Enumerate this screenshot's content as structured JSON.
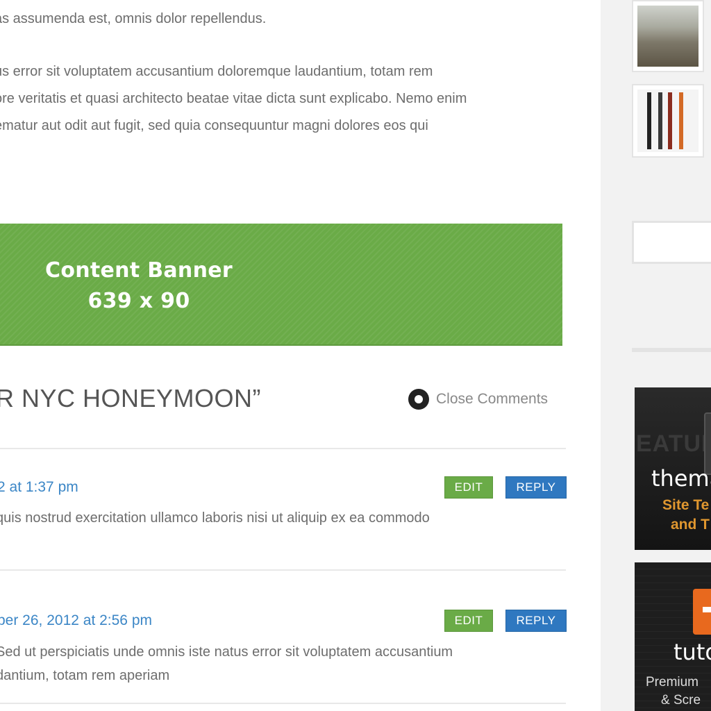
{
  "post": {
    "paragraph1": "as assumenda est, omnis dolor repellendus.",
    "paragraph2_lines": [
      "us error sit voluptatem accusantium doloremque laudantium, totam rem",
      "ore veritatis et quasi architecto beatae vitae dicta sunt explicabo. Nemo enim",
      "ematur aut odit aut fugit, sed quia consequuntur magni dolores eos qui"
    ]
  },
  "banner": {
    "line1": "Content Banner",
    "line2": "639 x 90",
    "color": "#6aab47"
  },
  "comments": {
    "title": "R NYC HONEYMOON”",
    "close_label": "Close Comments",
    "close_icon": "circle-toggle-icon",
    "items": [
      {
        "meta": "2 at 1:37 pm",
        "text_lines": [
          "quis nostrud exercitation ullamco laboris nisi ut aliquip ex ea commodo"
        ],
        "edit_label": "EDIT",
        "reply_label": "REPLY"
      },
      {
        "meta": "ber 26, 2012 at 2:56 pm",
        "text_lines": [
          "Sed ut perspiciatis unde omnis iste natus error sit voluptatem accusantium",
          "dantium, totam rem aperiam"
        ],
        "edit_label": "EDIT",
        "reply_label": "REPLY"
      }
    ]
  },
  "sidebar": {
    "ad1": {
      "faint_text": "EATUR",
      "big_text": "thema",
      "sub_line1": "Site Te",
      "sub_line2": "and T"
    },
    "ad2": {
      "big_text": "tuto",
      "sub_line1": "Premium",
      "sub_line2": "& Scre"
    }
  },
  "colors": {
    "link_blue": "#3b86c6",
    "edit_green": "#6aab47",
    "reply_blue": "#2f78c0",
    "ad_orange": "#e0972f"
  }
}
